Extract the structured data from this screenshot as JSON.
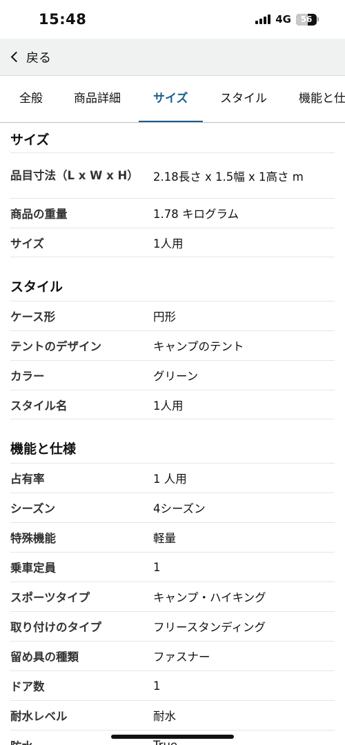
{
  "status": {
    "time": "15:48",
    "network": "4G",
    "battery": "56",
    "battery_level": 0.56
  },
  "nav": {
    "back_label": "戻る"
  },
  "tabs": [
    {
      "label": "全般",
      "active": false
    },
    {
      "label": "商品詳細",
      "active": false
    },
    {
      "label": "サイズ",
      "active": true
    },
    {
      "label": "スタイル",
      "active": false
    },
    {
      "label": "機能と仕様",
      "active": false
    }
  ],
  "sections": [
    {
      "title": "サイズ",
      "rows": [
        {
          "label": "品目寸法（L x W x H）",
          "value": "2.18長さ x 1.5幅 x 1高さ m"
        },
        {
          "label": "商品の重量",
          "value": "1.78 キログラム"
        },
        {
          "label": "サイズ",
          "value": "1人用"
        }
      ]
    },
    {
      "title": "スタイル",
      "rows": [
        {
          "label": "ケース形",
          "value": "円形"
        },
        {
          "label": "テントのデザイン",
          "value": "キャンプのテント"
        },
        {
          "label": "カラー",
          "value": "グリーン"
        },
        {
          "label": "スタイル名",
          "value": "1人用"
        }
      ]
    },
    {
      "title": "機能と仕様",
      "rows": [
        {
          "label": "占有率",
          "value": "1 人用"
        },
        {
          "label": "シーズン",
          "value": "4シーズン"
        },
        {
          "label": "特殊機能",
          "value": "軽量"
        },
        {
          "label": "乗車定員",
          "value": "1"
        },
        {
          "label": "スポーツタイプ",
          "value": "キャンプ・ハイキング"
        },
        {
          "label": "取り付けのタイプ",
          "value": "フリースタンディング"
        },
        {
          "label": "留め具の種類",
          "value": "ファスナー"
        },
        {
          "label": "ドア数",
          "value": "1"
        },
        {
          "label": "耐水レベル",
          "value": "耐水"
        },
        {
          "label": "防水",
          "value": "True"
        }
      ]
    }
  ]
}
